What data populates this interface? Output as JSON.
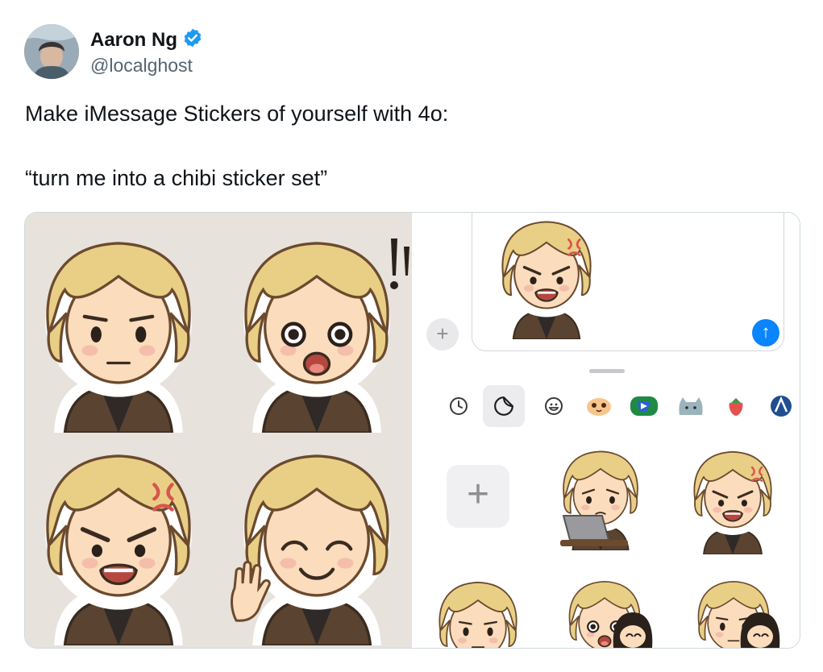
{
  "author": {
    "display_name": "Aaron Ng",
    "handle": "@localghost",
    "verified": true
  },
  "tweet": {
    "line1": "Make iMessage Stickers of yourself with 4o:",
    "line2": "“turn me into a chibi sticker set”"
  },
  "media": {
    "left_panel_stickers": [
      "neutral-chibi",
      "surprised-chibi",
      "angry-chibi",
      "happy-waving-chibi"
    ],
    "imessage": {
      "send_icon": "arrow-up",
      "tabs": [
        "clock-icon",
        "sticker-icon",
        "emoji-icon",
        "app-icon-1",
        "app-icon-2",
        "cat-icon",
        "strawberry-icon",
        "app-icon-3"
      ],
      "active_tab": "sticker-icon"
    }
  },
  "colors": {
    "verified_blue": "#1d9bf0",
    "send_blue": "#0a84ff",
    "hair": "#e9cf86",
    "jacket": "#5a4330",
    "anger_mark": "#d9534f"
  }
}
